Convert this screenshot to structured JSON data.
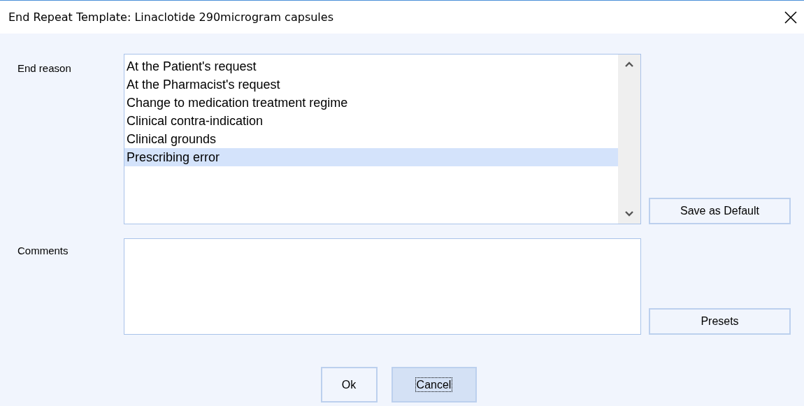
{
  "window": {
    "title": "End Repeat Template: Linaclotide 290microgram capsules"
  },
  "end_reason": {
    "label": "End reason",
    "items": [
      {
        "label": "At the Patient's request",
        "selected": false
      },
      {
        "label": "At the Pharmacist's request",
        "selected": false
      },
      {
        "label": "Change to medication treatment regime",
        "selected": false
      },
      {
        "label": "Clinical contra-indication",
        "selected": false
      },
      {
        "label": "Clinical grounds",
        "selected": false
      },
      {
        "label": "Prescribing error",
        "selected": true
      }
    ]
  },
  "save_default_button": "Save as Default",
  "comments": {
    "label": "Comments"
  },
  "presets_button": "Presets",
  "buttons": [
    {
      "label": "Ok",
      "focused": false
    },
    {
      "label": "Cancel",
      "focused": true
    }
  ]
}
